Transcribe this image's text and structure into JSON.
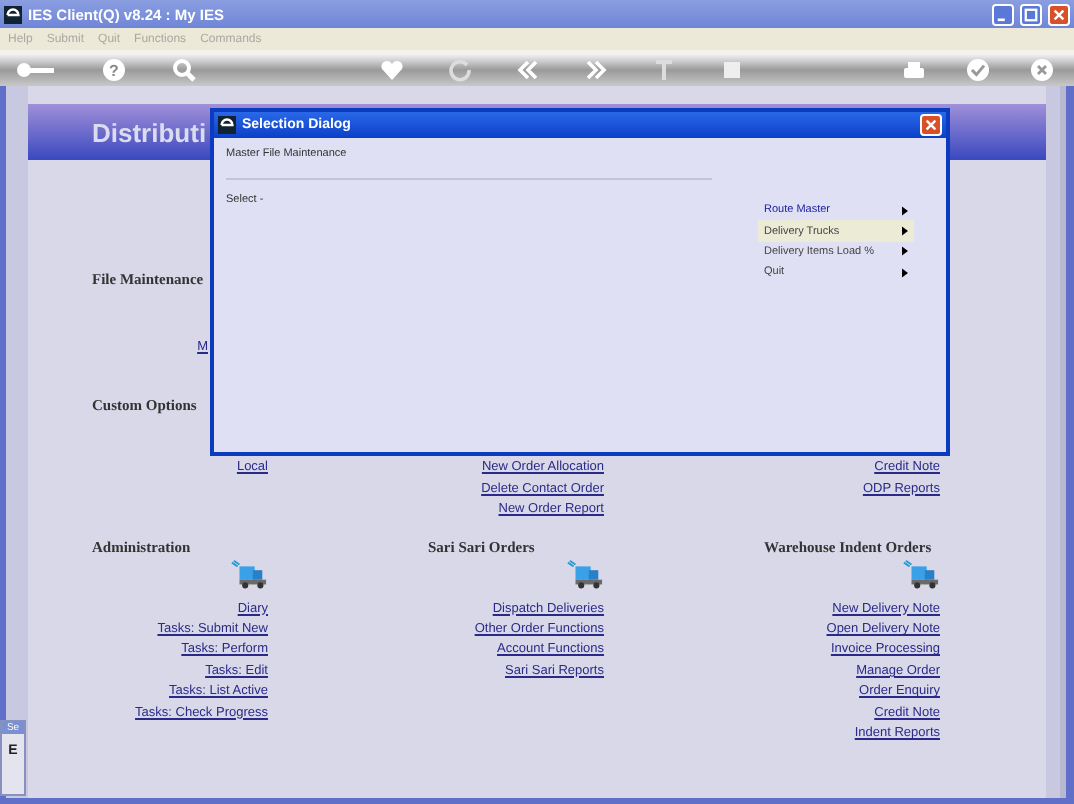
{
  "window": {
    "title": "IES Client(Q) v8.24 : My IES"
  },
  "menu": [
    {
      "label": "Help",
      "disabled": true
    },
    {
      "label": "Submit",
      "disabled": true
    },
    {
      "label": "Quit",
      "disabled": true
    },
    {
      "label": "Functions",
      "disabled": true
    },
    {
      "label": "Commands",
      "disabled": true
    }
  ],
  "toolbar": {
    "help_glyph": "?"
  },
  "page": {
    "title": "Distributi",
    "sections": [
      {
        "heading": "File Maintenance",
        "columns": [
          [
            "M"
          ],
          [],
          []
        ]
      },
      {
        "heading": "Custom Options",
        "columns": [
          [
            "Local"
          ],
          [
            "New Order Allocation",
            "Delete Contact Order",
            "New Order Report"
          ],
          [
            "Credit Note",
            "ODP Reports"
          ]
        ]
      }
    ],
    "groups": [
      {
        "heading": "Administration",
        "links": [
          "Diary",
          "Tasks: Submit New",
          "Tasks: Perform",
          "Tasks: Edit",
          "Tasks: List Active",
          "Tasks: Check Progress"
        ]
      },
      {
        "heading": "Sari Sari Orders",
        "links": [
          "Dispatch Deliveries",
          "Other Order Functions",
          "Account Functions",
          "Sari Sari Reports"
        ]
      },
      {
        "heading": "Warehouse Indent Orders",
        "links": [
          "New Delivery Note",
          "Open Delivery Note",
          "Invoice Processing",
          "Manage Order",
          "Order Enquiry",
          "Credit Note",
          "Indent Reports"
        ]
      }
    ]
  },
  "side_tab": {
    "label": "Se",
    "letter": "E"
  },
  "dialog": {
    "title": "Selection Dialog",
    "subtitle": "Master File Maintenance",
    "prompt": "Select -",
    "options": [
      {
        "label": "Route Master",
        "selected": false,
        "focused": true
      },
      {
        "label": "Delivery Trucks",
        "selected": true,
        "focused": false
      },
      {
        "label": "Delivery Items Load %",
        "selected": false,
        "focused": false
      },
      {
        "label": "Quit",
        "selected": false,
        "focused": false
      }
    ]
  }
}
